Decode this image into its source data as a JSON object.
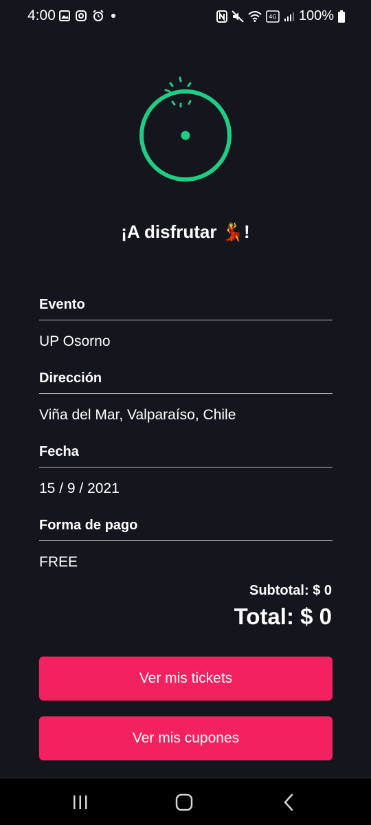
{
  "status_bar": {
    "time": "4:00",
    "battery": "100%",
    "left_icons": [
      "gallery-icon",
      "instagram-icon",
      "alarm-icon",
      "dot-icon"
    ],
    "right_icons": [
      "nfc-icon",
      "mute-icon",
      "wifi-icon",
      "volte-icon",
      "signal-icon",
      "battery-icon"
    ]
  },
  "main": {
    "title": "¡A disfrutar 💃!",
    "details": [
      {
        "label": "Evento",
        "value": "UP Osorno"
      },
      {
        "label": "Dirección",
        "value": "Viña del Mar, Valparaíso, Chile"
      },
      {
        "label": "Fecha",
        "value": "15 / 9 / 2021"
      },
      {
        "label": "Forma de pago",
        "value": "FREE"
      }
    ],
    "subtotal": "Subtotal: $ 0",
    "total": "Total: $ 0",
    "tickets_button": "Ver mis tickets",
    "coupons_button": "Ver mis cupones"
  },
  "colors": {
    "background": "#15161d",
    "accent_green": "#1fce84",
    "button_pink": "#f3215f"
  },
  "nav_bar": {
    "icons": [
      "recents-icon",
      "home-icon",
      "back-icon"
    ]
  }
}
